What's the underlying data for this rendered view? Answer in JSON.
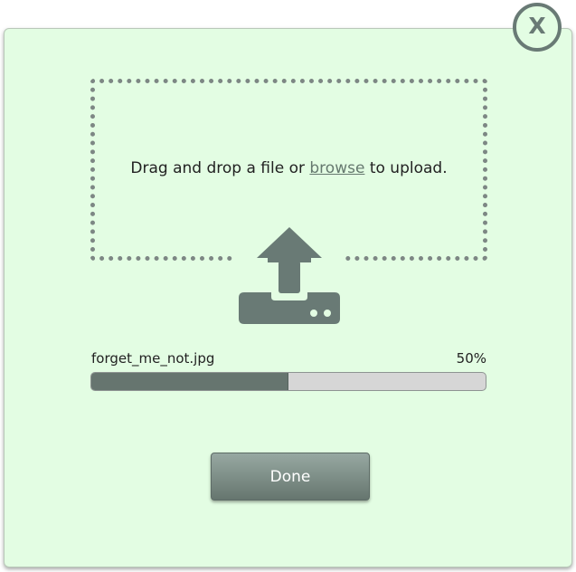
{
  "dialog": {
    "close_label": "X",
    "dropzone": {
      "text_before": "Drag and drop a file or ",
      "browse_link": "browse",
      "text_after": " to upload.",
      "icon": "upload-tray-icon"
    },
    "upload": {
      "filename": "forget_me_not.jpg",
      "percent_label": "50%",
      "progress_fraction": 0.5
    },
    "done_label": "Done"
  },
  "colors": {
    "background": "#e3fde3",
    "accent": "#697a75",
    "progress_track": "#d6d6d6"
  }
}
